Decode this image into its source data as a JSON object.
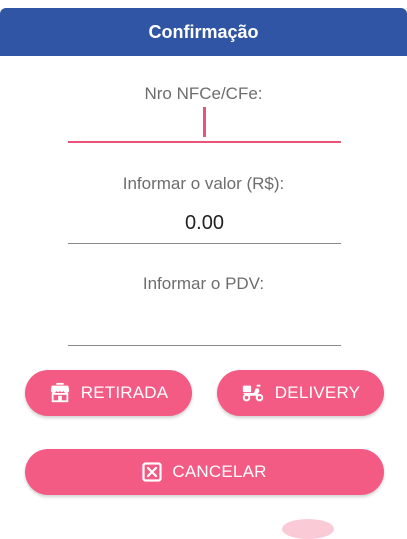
{
  "dialog": {
    "title": "Confirmação",
    "fields": {
      "nfce_label": "Nro NFCe/CFe:",
      "nfce_value": "",
      "valor_label": "Informar o valor (R$):",
      "valor_value": "0.00",
      "pdv_label": "Informar o PDV:",
      "pdv_value": ""
    },
    "buttons": {
      "retirada": "RETIRADA",
      "delivery": "DELIVERY",
      "cancelar": "CANCELAR"
    }
  },
  "colors": {
    "header": "#2f55a4",
    "accent": "#f35b84",
    "underline_active": "#e8537a"
  },
  "icons": {
    "retirada": "store-icon",
    "delivery": "scooter-icon",
    "cancelar": "close-box-icon"
  }
}
